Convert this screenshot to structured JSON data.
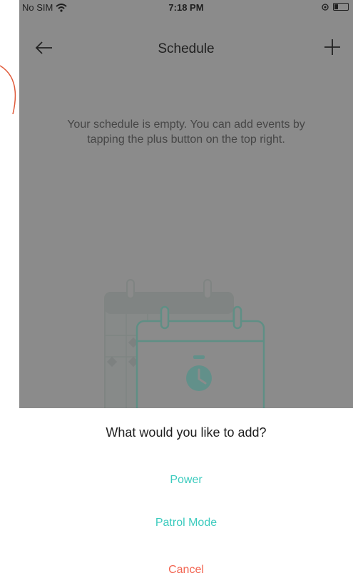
{
  "status_bar": {
    "carrier": "No SIM",
    "time": "7:18 PM"
  },
  "nav": {
    "title": "Schedule",
    "back_icon": "arrow-left-icon",
    "add_icon": "plus-icon"
  },
  "empty_state": {
    "message": "Your schedule is empty. You can add events by tapping the plus button on the top right."
  },
  "action_sheet": {
    "title": "What would you like to add?",
    "options": [
      {
        "label": "Power"
      },
      {
        "label": "Patrol Mode"
      }
    ],
    "cancel_label": "Cancel"
  },
  "colors": {
    "accent": "#3ccbbe",
    "cancel": "#f26552",
    "overlay": "#8b8b8b"
  }
}
